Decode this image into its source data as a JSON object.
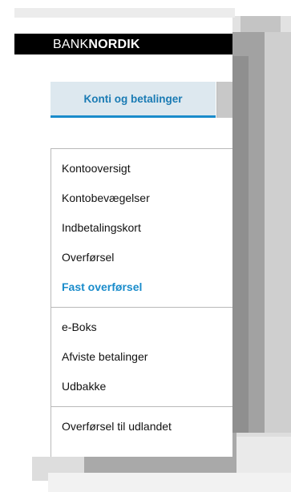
{
  "brand": {
    "part1": "BANK",
    "part2": "NORDIK"
  },
  "tab": {
    "label": "Konti og betalinger"
  },
  "menu": {
    "group1": [
      {
        "label": "Kontooversigt"
      },
      {
        "label": "Kontobevægelser"
      },
      {
        "label": "Indbetalingskort"
      },
      {
        "label": "Overførsel"
      },
      {
        "label": "Fast overførsel",
        "active": true
      }
    ],
    "group2": [
      {
        "label": "e-Boks"
      },
      {
        "label": "Afviste betalinger"
      },
      {
        "label": "Udbakke"
      }
    ],
    "group3": [
      {
        "label": "Overførsel til udlandet"
      }
    ]
  },
  "colors": {
    "accent": "#1a8ccb",
    "tab_bg": "#dde8ef",
    "logo_bg": "#000000"
  }
}
